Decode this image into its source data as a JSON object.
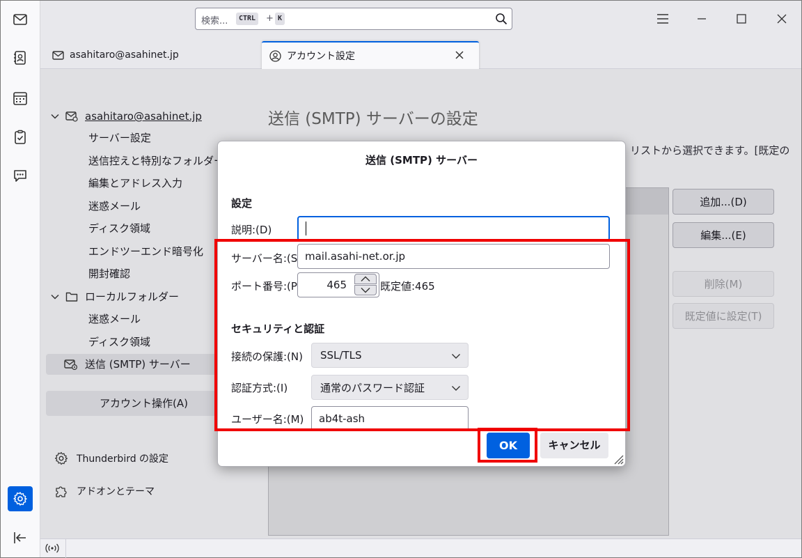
{
  "titlebar": {
    "search_placeholder": "検索...",
    "key_ctrl": "CTRL",
    "key_plus": "+",
    "key_k": "K"
  },
  "tabs": [
    {
      "label": "asahitaro@asahinet.jp"
    },
    {
      "label": "アカウント設定"
    }
  ],
  "sidebar": {
    "account": "asahitaro@asahinet.jp",
    "account_items": [
      "サーバー設定",
      "送信控えと特別なフォルダー",
      "編集とアドレス入力",
      "迷惑メール",
      "ディスク領域",
      "エンドツーエンド暗号化",
      "開封確認"
    ],
    "local": "ローカルフォルダー",
    "local_items": [
      "迷惑メール",
      "ディスク領域"
    ],
    "smtp": "送信 (SMTP) サーバー",
    "account_ops": "アカウント操作(A)",
    "tb_settings": "Thunderbird の設定",
    "addons": "アドオンとテーマ"
  },
  "content": {
    "title": "送信 (SMTP) サーバーの設定",
    "desc": "リストから選択できます。[既定の",
    "buttons": {
      "add": "追加...(D)",
      "edit": "編集...(E)",
      "delete": "削除(M)",
      "set_default": "既定値に設定(T)"
    }
  },
  "dialog": {
    "title": "送信 (SMTP) サーバー",
    "settings_heading": "設定",
    "desc_label": "説明:(D)",
    "desc_value": "",
    "server_label": "サーバー名:(S)",
    "server_value": "mail.asahi-net.or.jp",
    "port_label": "ポート番号:(P)",
    "port_value": "465",
    "port_default": "既定値:465",
    "security_heading": "セキュリティと認証",
    "conn_label": "接続の保護:(N)",
    "conn_value": "SSL/TLS",
    "auth_label": "認証方式:(I)",
    "auth_value": "通常のパスワード認証",
    "user_label": "ユーザー名:(M)",
    "user_value": "ab4t-ash",
    "ok": "OK",
    "cancel": "キャンセル"
  },
  "colors": {
    "accent": "#0060df",
    "highlight": "#f00000"
  }
}
